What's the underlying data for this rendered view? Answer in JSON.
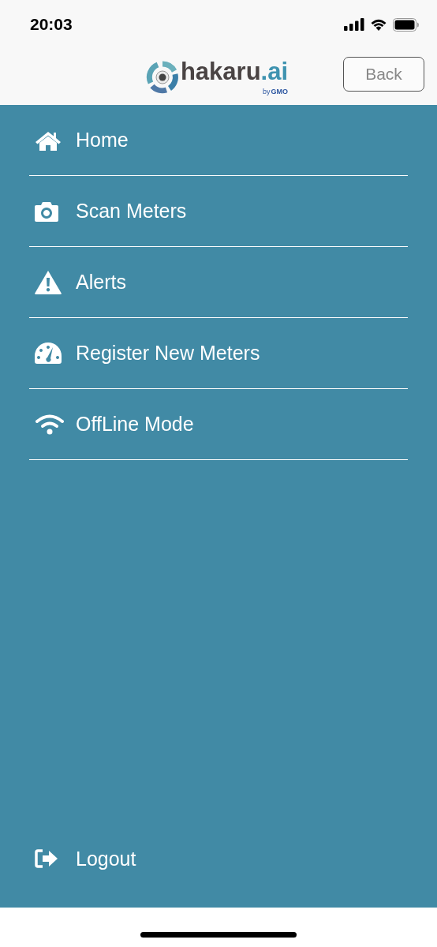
{
  "status_bar": {
    "time": "20:03"
  },
  "header": {
    "logo": {
      "name": "hakaru",
      "suffix": ".ai",
      "by": "by",
      "brand": "GMO"
    },
    "back_button": "Back"
  },
  "menu": [
    {
      "label": "Home",
      "kind": "home"
    },
    {
      "label": "Scan Meters",
      "kind": "camera"
    },
    {
      "label": "Alerts",
      "kind": "alert"
    },
    {
      "label": "Register New Meters",
      "kind": "gauge"
    },
    {
      "label": "OffLine Mode",
      "kind": "wifi"
    }
  ],
  "logout": {
    "label": "Logout",
    "kind": "logout"
  }
}
